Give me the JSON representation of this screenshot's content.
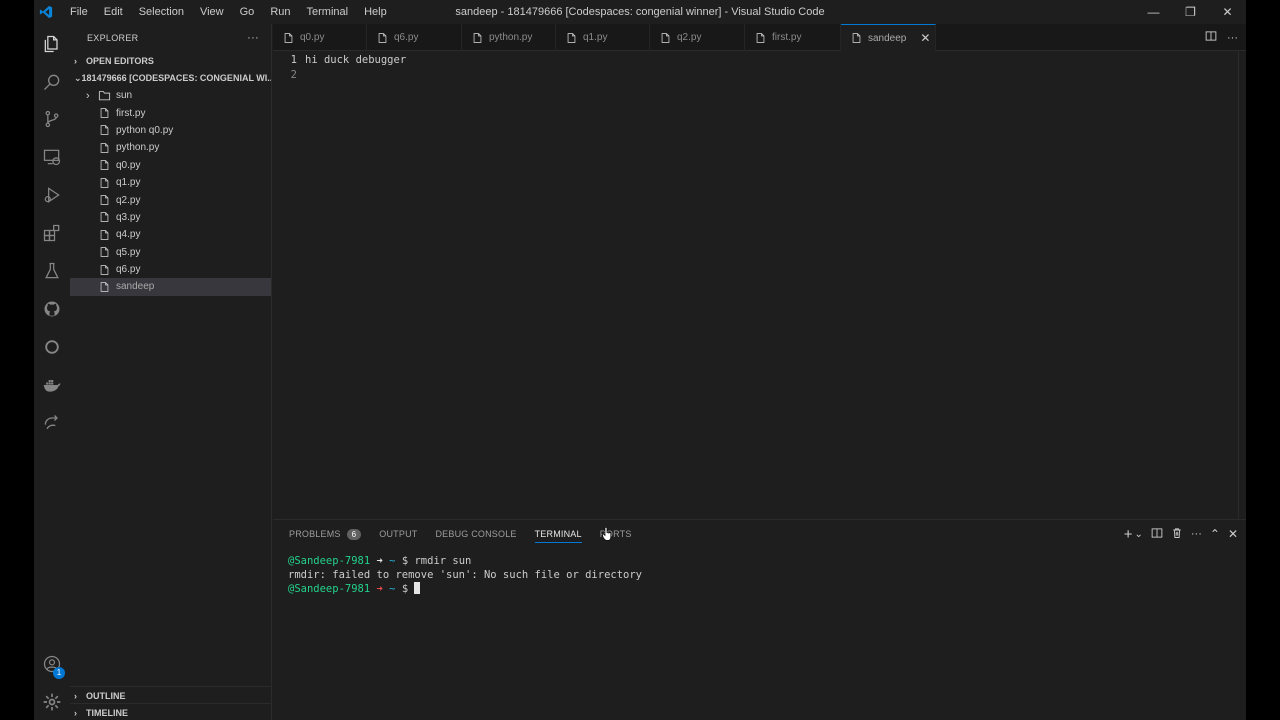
{
  "window": {
    "title": "sandeep - 181479666 [Codespaces: congenial winner] - Visual Studio Code",
    "menu": [
      "File",
      "Edit",
      "Selection",
      "View",
      "Go",
      "Run",
      "Terminal",
      "Help"
    ],
    "controls": {
      "minimize": "—",
      "restore": "❐",
      "close": "✕"
    }
  },
  "activity": {
    "items": [
      "explorer-icon",
      "search-icon",
      "source-control-icon",
      "remote-explorer-icon",
      "run-debug-icon",
      "extensions-icon",
      "testing-icon",
      "github-icon",
      "copilot-icon",
      "docker-icon",
      "live-share-icon"
    ],
    "accounts_badge": "1"
  },
  "sidebar": {
    "header": "EXPLORER",
    "more": "···",
    "open_editors": "OPEN EDITORS",
    "workspace": "181479666 [CODESPACES: CONGENIAL WI...",
    "files": [
      {
        "name": "sun",
        "type": "folder"
      },
      {
        "name": "first.py",
        "type": "file"
      },
      {
        "name": "python q0.py",
        "type": "file"
      },
      {
        "name": "python.py",
        "type": "file"
      },
      {
        "name": "q0.py",
        "type": "file"
      },
      {
        "name": "q1.py",
        "type": "file"
      },
      {
        "name": "q2.py",
        "type": "file"
      },
      {
        "name": "q3.py",
        "type": "file"
      },
      {
        "name": "q4.py",
        "type": "file"
      },
      {
        "name": "q5.py",
        "type": "file"
      },
      {
        "name": "q6.py",
        "type": "file"
      },
      {
        "name": "sandeep",
        "type": "file",
        "selected": true
      }
    ],
    "outline": "OUTLINE",
    "timeline": "TIMELINE"
  },
  "editor": {
    "tabs": [
      {
        "label": "q0.py",
        "active": false
      },
      {
        "label": "q6.py",
        "active": false
      },
      {
        "label": "python.py",
        "active": false
      },
      {
        "label": "q1.py",
        "active": false
      },
      {
        "label": "q2.py",
        "active": false
      },
      {
        "label": "first.py",
        "active": false
      },
      {
        "label": "sandeep",
        "active": true
      }
    ],
    "lines": [
      {
        "n": "1",
        "text": "hi duck debugger"
      },
      {
        "n": "2",
        "text": ""
      }
    ]
  },
  "panel": {
    "tabs": [
      "PROBLEMS",
      "OUTPUT",
      "DEBUG CONSOLE",
      "TERMINAL",
      "PORTS"
    ],
    "problems_count": "6",
    "active_tab": "TERMINAL",
    "terminal": {
      "user": "@Sandeep-7981",
      "arrow": "➜",
      "tilde": "~",
      "prompt": "$",
      "command": "rmdir sun",
      "output": "rmdir: failed to remove 'sun': No such file or directory"
    },
    "actions": {
      "add": "+",
      "dropdown": "⌄",
      "more": "···",
      "maximize": "⌃",
      "close": "✕"
    }
  }
}
